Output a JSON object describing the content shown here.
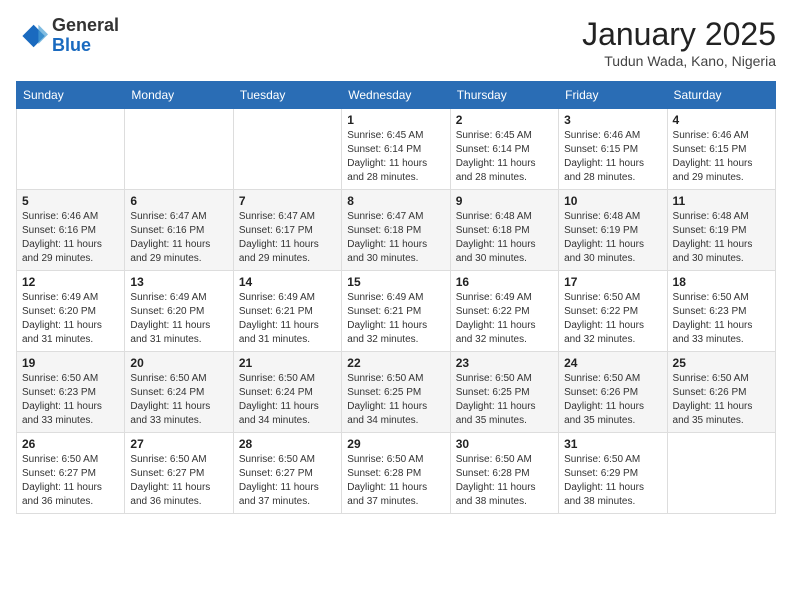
{
  "header": {
    "logo_general": "General",
    "logo_blue": "Blue",
    "month_title": "January 2025",
    "subtitle": "Tudun Wada, Kano, Nigeria"
  },
  "days_of_week": [
    "Sunday",
    "Monday",
    "Tuesday",
    "Wednesday",
    "Thursday",
    "Friday",
    "Saturday"
  ],
  "weeks": [
    [
      {
        "day": "",
        "info": ""
      },
      {
        "day": "",
        "info": ""
      },
      {
        "day": "",
        "info": ""
      },
      {
        "day": "1",
        "info": "Sunrise: 6:45 AM\nSunset: 6:14 PM\nDaylight: 11 hours and 28 minutes."
      },
      {
        "day": "2",
        "info": "Sunrise: 6:45 AM\nSunset: 6:14 PM\nDaylight: 11 hours and 28 minutes."
      },
      {
        "day": "3",
        "info": "Sunrise: 6:46 AM\nSunset: 6:15 PM\nDaylight: 11 hours and 28 minutes."
      },
      {
        "day": "4",
        "info": "Sunrise: 6:46 AM\nSunset: 6:15 PM\nDaylight: 11 hours and 29 minutes."
      }
    ],
    [
      {
        "day": "5",
        "info": "Sunrise: 6:46 AM\nSunset: 6:16 PM\nDaylight: 11 hours and 29 minutes."
      },
      {
        "day": "6",
        "info": "Sunrise: 6:47 AM\nSunset: 6:16 PM\nDaylight: 11 hours and 29 minutes."
      },
      {
        "day": "7",
        "info": "Sunrise: 6:47 AM\nSunset: 6:17 PM\nDaylight: 11 hours and 29 minutes."
      },
      {
        "day": "8",
        "info": "Sunrise: 6:47 AM\nSunset: 6:18 PM\nDaylight: 11 hours and 30 minutes."
      },
      {
        "day": "9",
        "info": "Sunrise: 6:48 AM\nSunset: 6:18 PM\nDaylight: 11 hours and 30 minutes."
      },
      {
        "day": "10",
        "info": "Sunrise: 6:48 AM\nSunset: 6:19 PM\nDaylight: 11 hours and 30 minutes."
      },
      {
        "day": "11",
        "info": "Sunrise: 6:48 AM\nSunset: 6:19 PM\nDaylight: 11 hours and 30 minutes."
      }
    ],
    [
      {
        "day": "12",
        "info": "Sunrise: 6:49 AM\nSunset: 6:20 PM\nDaylight: 11 hours and 31 minutes."
      },
      {
        "day": "13",
        "info": "Sunrise: 6:49 AM\nSunset: 6:20 PM\nDaylight: 11 hours and 31 minutes."
      },
      {
        "day": "14",
        "info": "Sunrise: 6:49 AM\nSunset: 6:21 PM\nDaylight: 11 hours and 31 minutes."
      },
      {
        "day": "15",
        "info": "Sunrise: 6:49 AM\nSunset: 6:21 PM\nDaylight: 11 hours and 32 minutes."
      },
      {
        "day": "16",
        "info": "Sunrise: 6:49 AM\nSunset: 6:22 PM\nDaylight: 11 hours and 32 minutes."
      },
      {
        "day": "17",
        "info": "Sunrise: 6:50 AM\nSunset: 6:22 PM\nDaylight: 11 hours and 32 minutes."
      },
      {
        "day": "18",
        "info": "Sunrise: 6:50 AM\nSunset: 6:23 PM\nDaylight: 11 hours and 33 minutes."
      }
    ],
    [
      {
        "day": "19",
        "info": "Sunrise: 6:50 AM\nSunset: 6:23 PM\nDaylight: 11 hours and 33 minutes."
      },
      {
        "day": "20",
        "info": "Sunrise: 6:50 AM\nSunset: 6:24 PM\nDaylight: 11 hours and 33 minutes."
      },
      {
        "day": "21",
        "info": "Sunrise: 6:50 AM\nSunset: 6:24 PM\nDaylight: 11 hours and 34 minutes."
      },
      {
        "day": "22",
        "info": "Sunrise: 6:50 AM\nSunset: 6:25 PM\nDaylight: 11 hours and 34 minutes."
      },
      {
        "day": "23",
        "info": "Sunrise: 6:50 AM\nSunset: 6:25 PM\nDaylight: 11 hours and 35 minutes."
      },
      {
        "day": "24",
        "info": "Sunrise: 6:50 AM\nSunset: 6:26 PM\nDaylight: 11 hours and 35 minutes."
      },
      {
        "day": "25",
        "info": "Sunrise: 6:50 AM\nSunset: 6:26 PM\nDaylight: 11 hours and 35 minutes."
      }
    ],
    [
      {
        "day": "26",
        "info": "Sunrise: 6:50 AM\nSunset: 6:27 PM\nDaylight: 11 hours and 36 minutes."
      },
      {
        "day": "27",
        "info": "Sunrise: 6:50 AM\nSunset: 6:27 PM\nDaylight: 11 hours and 36 minutes."
      },
      {
        "day": "28",
        "info": "Sunrise: 6:50 AM\nSunset: 6:27 PM\nDaylight: 11 hours and 37 minutes."
      },
      {
        "day": "29",
        "info": "Sunrise: 6:50 AM\nSunset: 6:28 PM\nDaylight: 11 hours and 37 minutes."
      },
      {
        "day": "30",
        "info": "Sunrise: 6:50 AM\nSunset: 6:28 PM\nDaylight: 11 hours and 38 minutes."
      },
      {
        "day": "31",
        "info": "Sunrise: 6:50 AM\nSunset: 6:29 PM\nDaylight: 11 hours and 38 minutes."
      },
      {
        "day": "",
        "info": ""
      }
    ]
  ]
}
